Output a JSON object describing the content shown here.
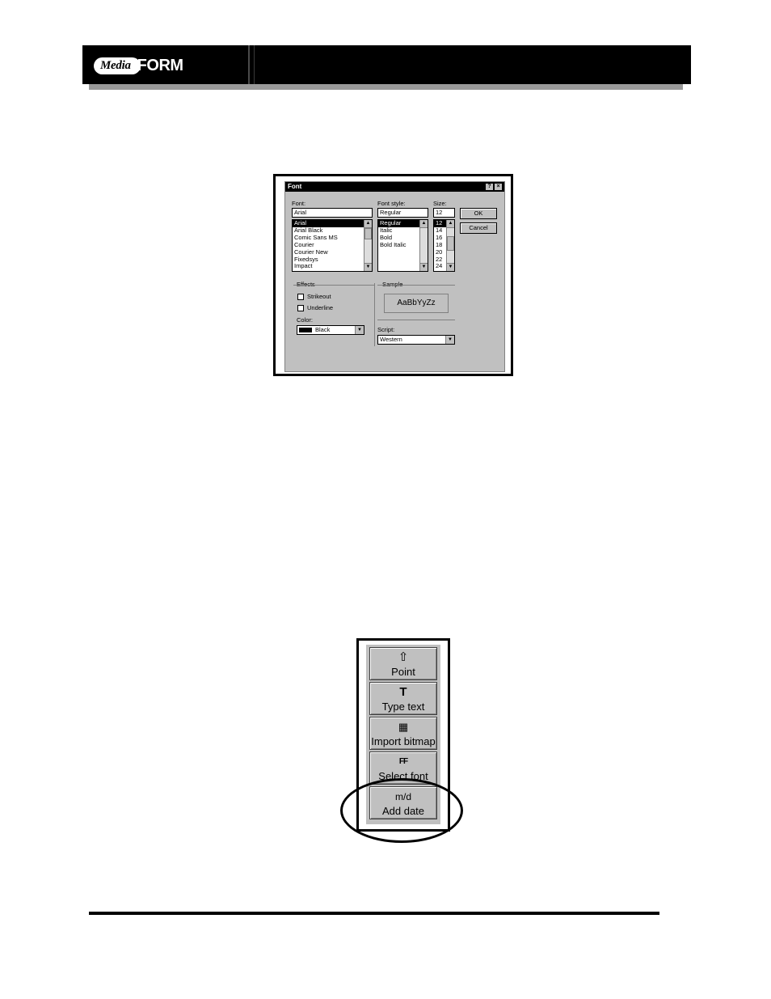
{
  "header": {
    "logo_media": "Media",
    "logo_form": "FORM"
  },
  "font_dialog": {
    "title": "Font",
    "help_glyph": "?",
    "close_glyph": "×",
    "font_label": "Font:",
    "font_value": "Arial",
    "fonts": [
      "Arial",
      "Arial Black",
      "Comic Sans MS",
      "Courier",
      "Courier New",
      "Fixedsys",
      "Impact"
    ],
    "font_style_label": "Font style:",
    "font_style_value": "Regular",
    "styles": [
      "Regular",
      "Italic",
      "Bold",
      "Bold Italic"
    ],
    "size_label": "Size:",
    "size_value": "12",
    "sizes": [
      "12",
      "14",
      "16",
      "18",
      "20",
      "22",
      "24"
    ],
    "ok_label": "OK",
    "cancel_label": "Cancel",
    "effects_label": "Effects",
    "strikeout_label": "Strikeout",
    "underline_label": "Underline",
    "color_label": "Color:",
    "color_value": "Black",
    "sample_label": "Sample",
    "sample_text": "AaBbYyZz",
    "script_label": "Script:",
    "script_value": "Western"
  },
  "toolbar": {
    "tools": [
      {
        "icon": "⇧",
        "label": "Point"
      },
      {
        "icon": "T",
        "label": "Type text"
      },
      {
        "icon": "▦",
        "label": "Import bitmap"
      },
      {
        "icon": "FF",
        "label": "Select font"
      },
      {
        "icon": "m/d",
        "label": "Add date"
      }
    ]
  }
}
